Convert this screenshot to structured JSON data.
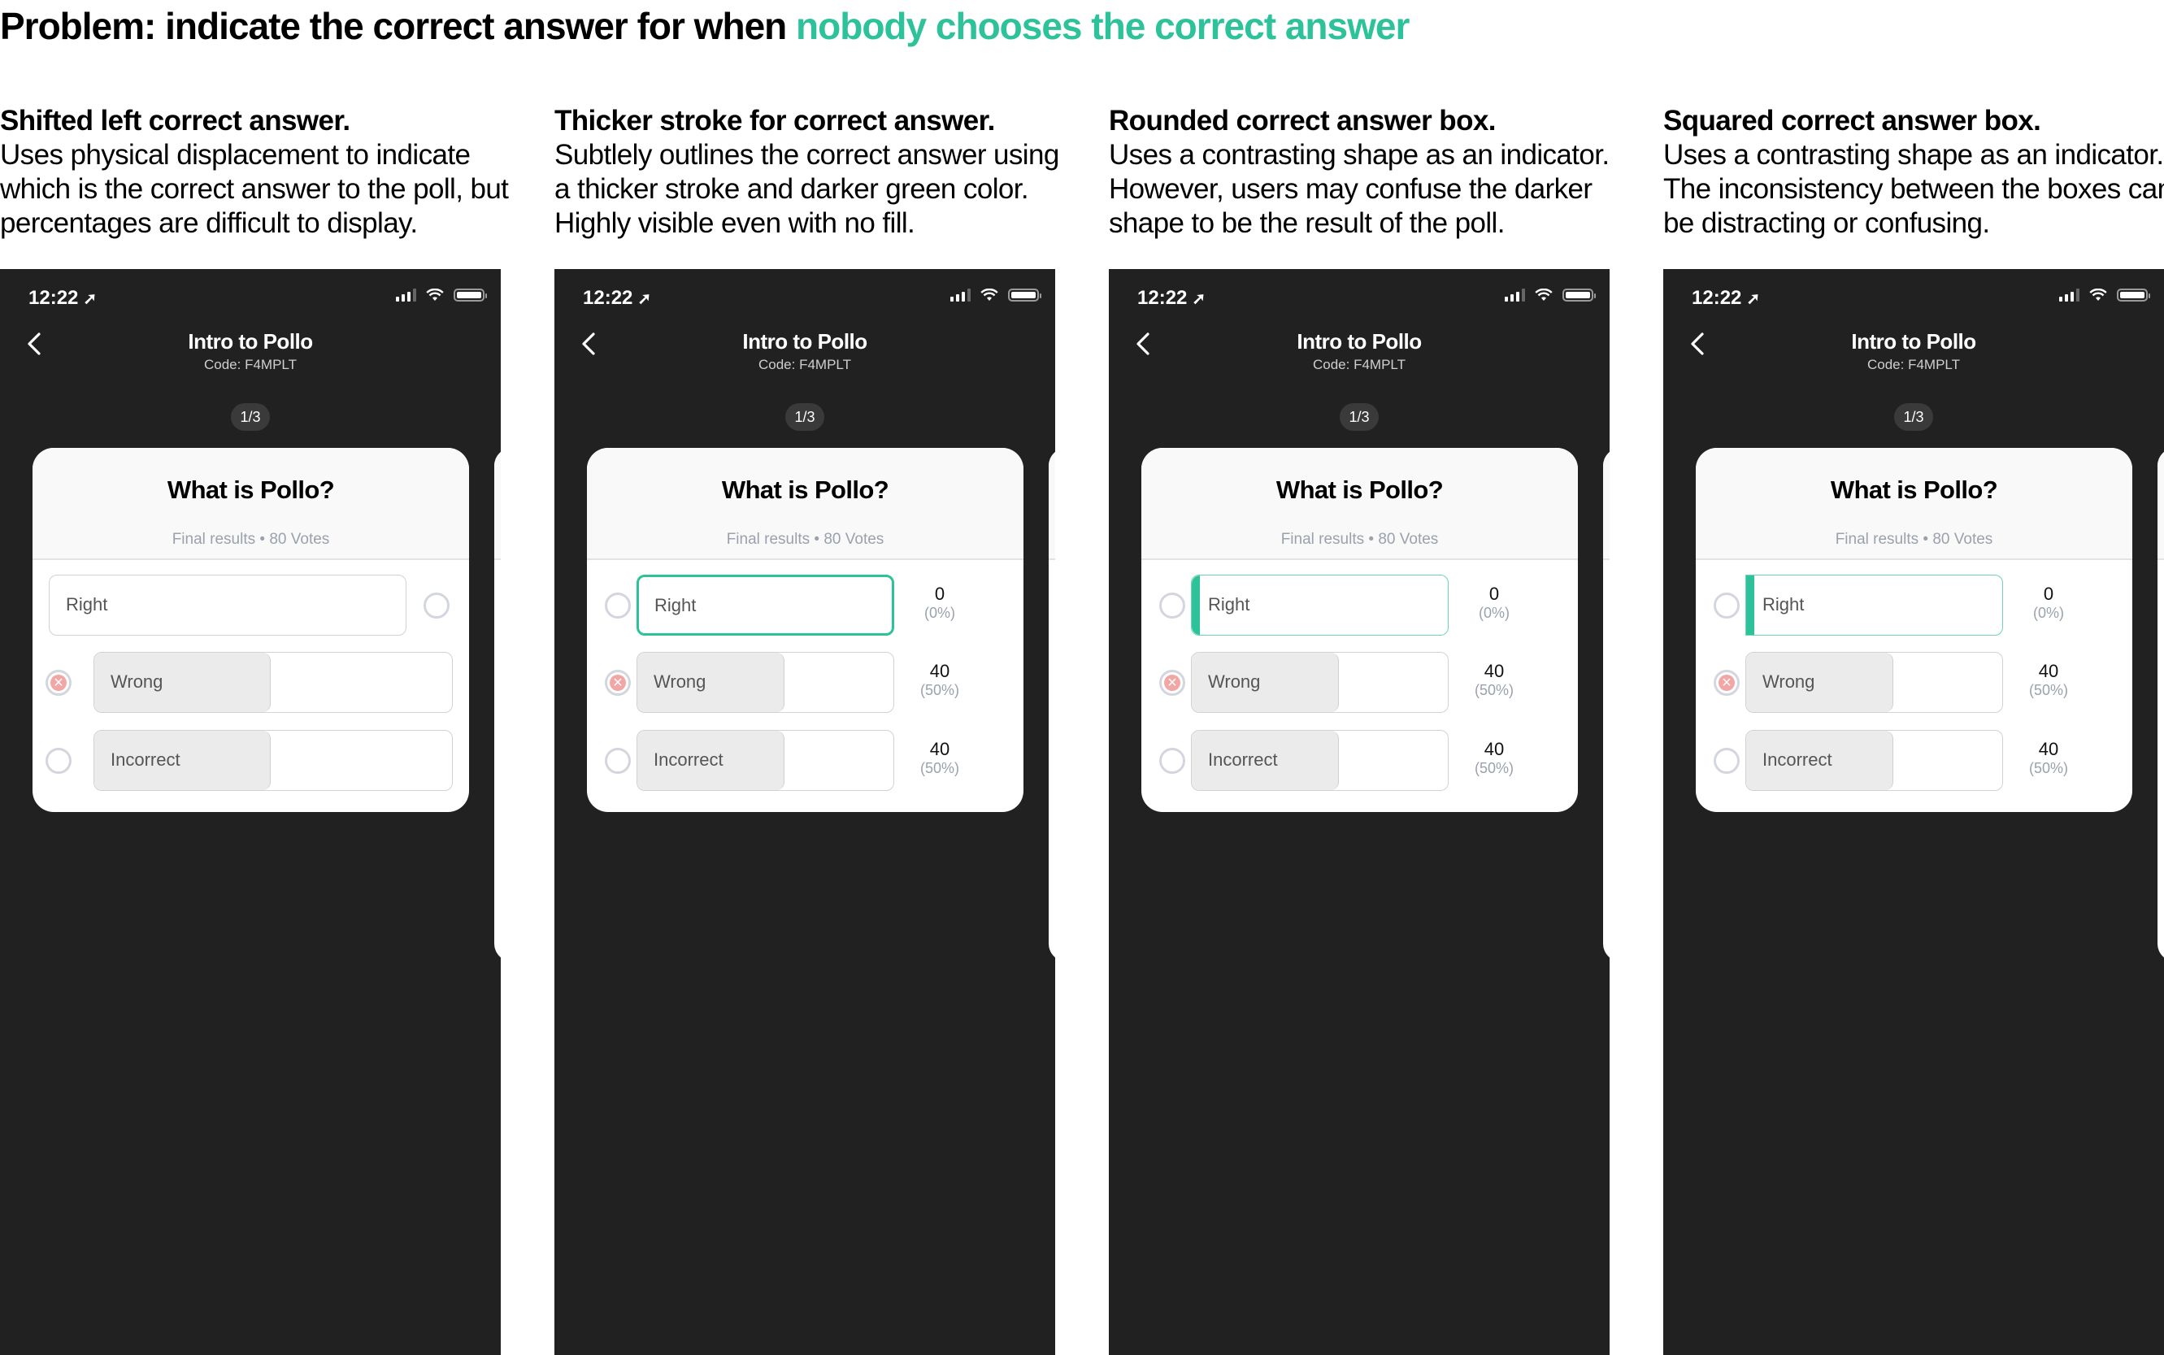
{
  "header": {
    "problem_prefix": "Problem: indicate the correct answer for when ",
    "problem_highlight": "nobody chooses the correct answer",
    "accent_color": "#2ec29a"
  },
  "phone": {
    "time": "12:22",
    "location_icon": "location-arrow-icon",
    "title": "Intro to Pollo",
    "code": "Code: F4MPLT",
    "page_indicator": "1/3",
    "question": "What is Pollo?",
    "results": "Final results • 80 Votes"
  },
  "variants": [
    {
      "title": "Shifted left correct answer.",
      "body": "Uses physical displacement to indicate which is the correct answer to the poll, but percentages are difficult to display."
    },
    {
      "title": "Thicker stroke for correct answer.",
      "body": "Subtlely outlines the correct answer using a thicker stroke and darker green color. Highly visible even with no fill."
    },
    {
      "title": "Rounded correct answer box.",
      "body": "Uses a contrasting shape as an indicator. However, users may confuse the darker shape to be the result of the poll."
    },
    {
      "title": "Squared correct answer box.",
      "body": "Uses a contrasting shape as an indicator. The inconsistency between the boxes can be distracting or confusing."
    }
  ],
  "options": [
    {
      "label": "Right",
      "votes": "0",
      "percent": "(0%)",
      "share": 0,
      "correct": true,
      "user_choice": false
    },
    {
      "label": "Wrong",
      "votes": "40",
      "percent": "(50%)",
      "share": 0.5,
      "correct": false,
      "user_choice": true
    },
    {
      "label": "Incorrect",
      "votes": "40",
      "percent": "(50%)",
      "share": 0.5,
      "correct": false,
      "user_choice": false
    }
  ]
}
